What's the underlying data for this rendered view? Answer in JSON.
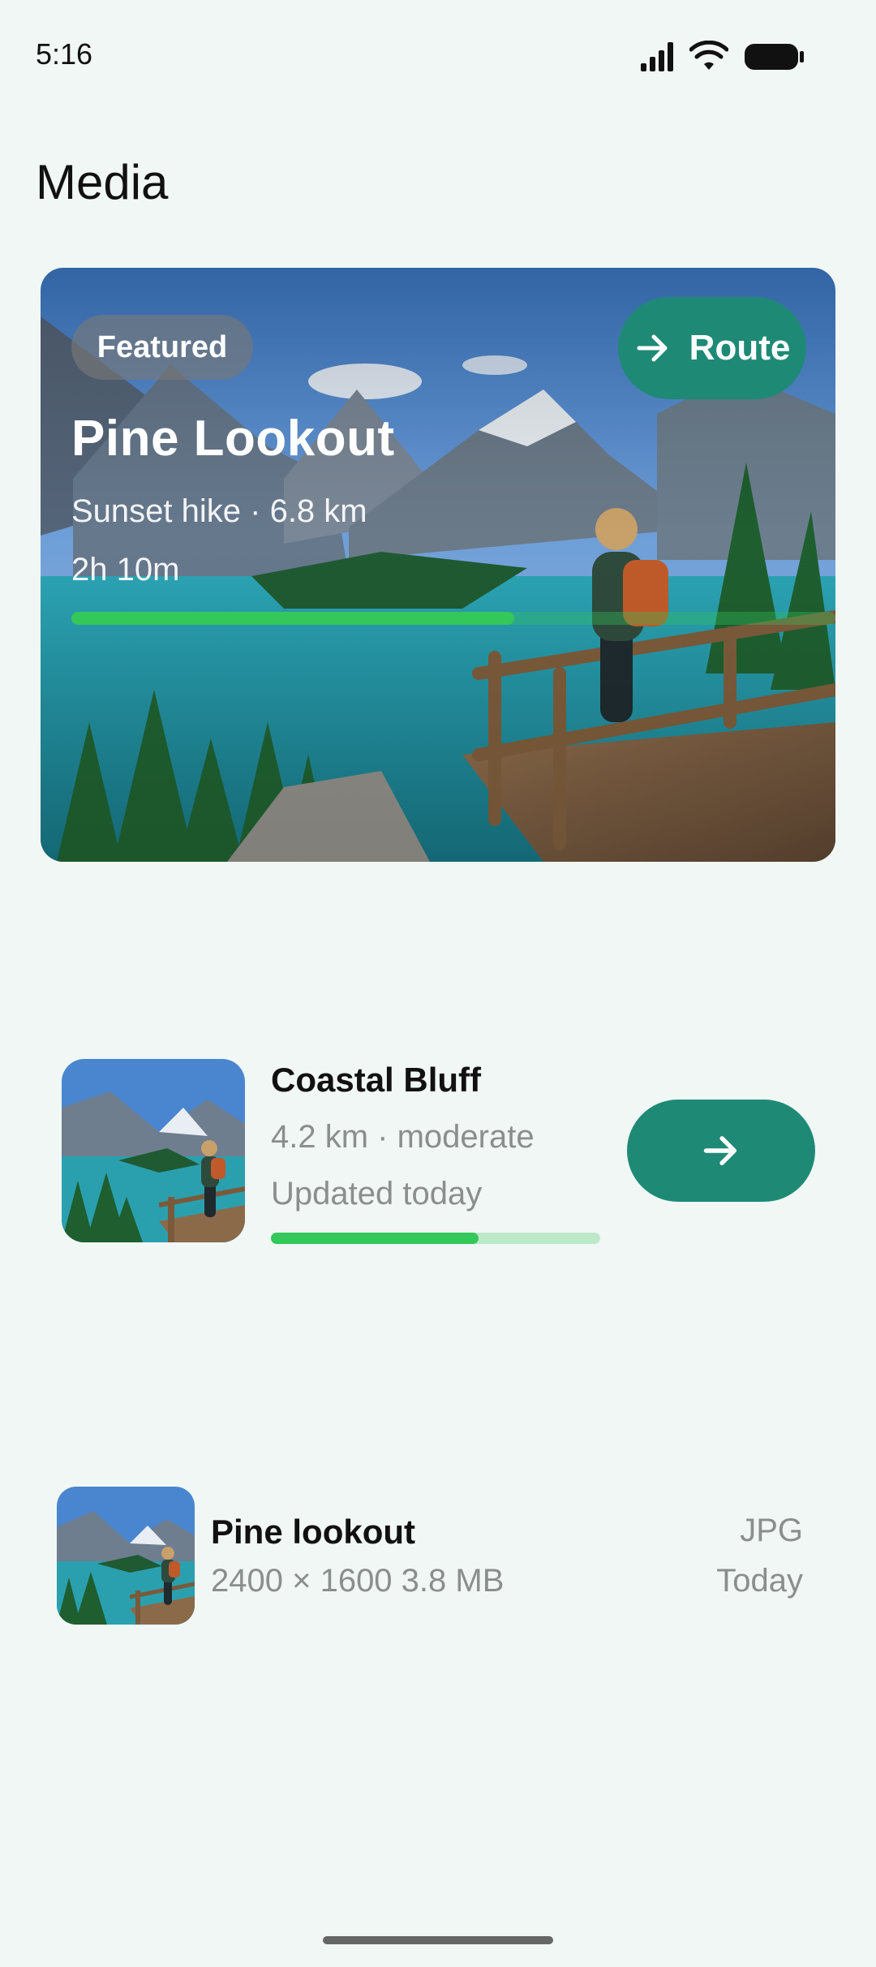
{
  "status_bar": {
    "time": "5:16",
    "icons": [
      "signal-icon",
      "wifi-icon",
      "battery-icon"
    ]
  },
  "page": {
    "title": "Media"
  },
  "featured": {
    "chip": "Featured",
    "title": "Pine Lookout",
    "subtitle": "Sunset hike · 6.8 km",
    "duration": "2h 10m",
    "progress_percent": 58,
    "route_button_label": "Route",
    "route_icon": "arrow-right-icon",
    "image": "mountain-lake-hiker-photo"
  },
  "coastal": {
    "title": "Coastal Bluff",
    "subtitle": "4.2 km · moderate",
    "updated": "Updated today",
    "progress_percent": 63,
    "button_icon": "arrow-right-icon",
    "image": "mountain-lake-hiker-thumbnail"
  },
  "file_item": {
    "title": "Pine lookout",
    "meta": "2400 × 1600 3.8 MB",
    "format": "JPG",
    "date": "Today",
    "image": "mountain-lake-hiker-thumbnail"
  },
  "colors": {
    "background": "#F0F7F4",
    "accent": "#1E8A76",
    "progress": "#34C759",
    "secondary_text": "#8A8F8D"
  }
}
